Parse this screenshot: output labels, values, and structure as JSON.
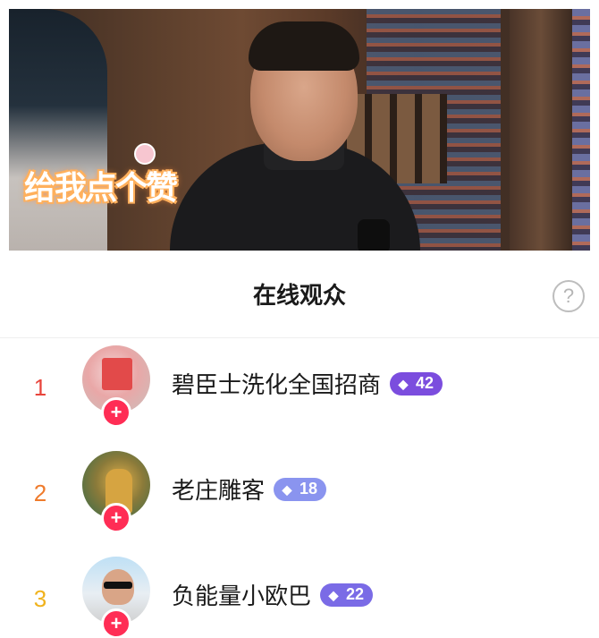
{
  "video": {
    "sticker_text": "给我点个赞"
  },
  "header": {
    "title": "在线观众",
    "help_glyph": "?"
  },
  "audience": [
    {
      "rank": "1",
      "rank_color": "#e8453c",
      "name": "碧臣士洗化全国招商",
      "level": "42",
      "badge_color": "#7b4dde",
      "avatar": "brand-avatar"
    },
    {
      "rank": "2",
      "rank_color": "#ef7b2c",
      "name": "老庄雕客",
      "level": "18",
      "badge_color": "#8a94ef",
      "avatar": "cartoon-avatar"
    },
    {
      "rank": "3",
      "rank_color": "#f0b21c",
      "name": "负能量小欧巴",
      "level": "22",
      "badge_color": "#7a6be6",
      "avatar": "portrait-avatar"
    }
  ],
  "follow_glyph": "+",
  "gem_glyph": "◆"
}
